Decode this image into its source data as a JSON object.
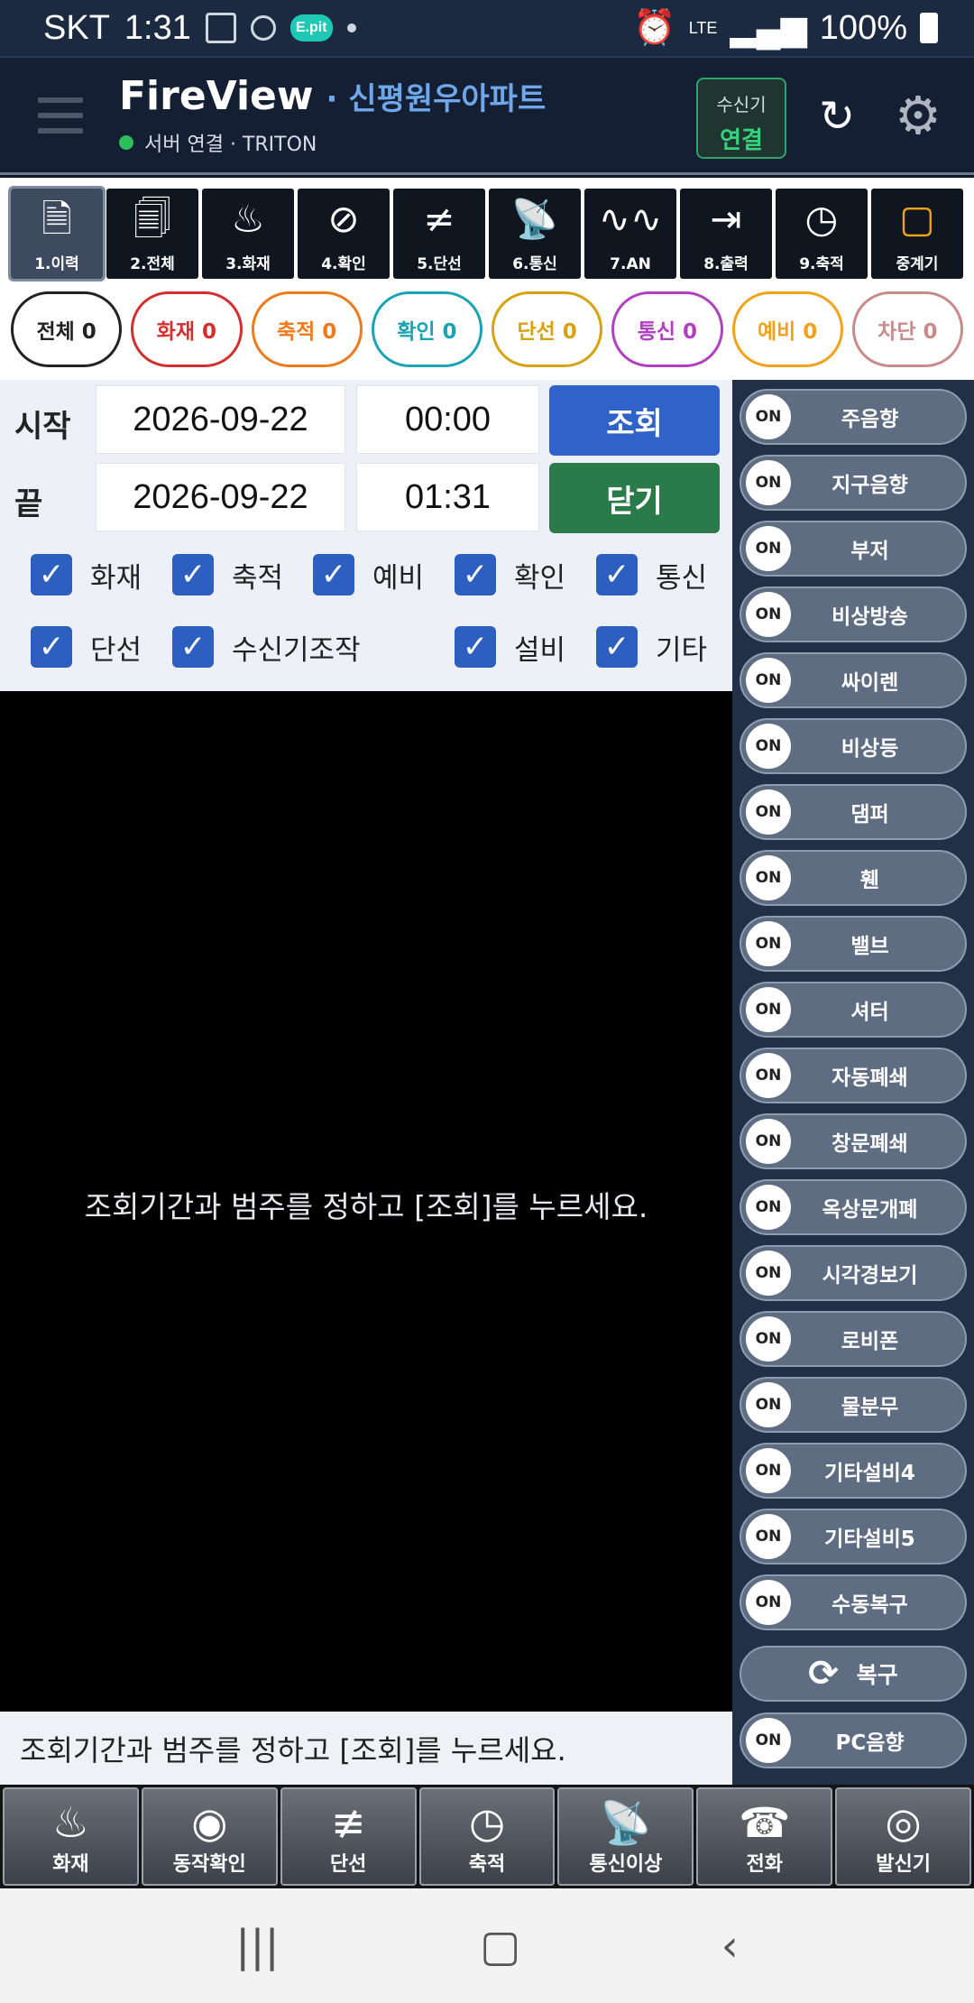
{
  "statusbar": {
    "carrier": "SKT",
    "time": "1:31",
    "notif_badge": "E.pit",
    "network": "LTE",
    "battery": "100%"
  },
  "header": {
    "app_title": "FireView",
    "site_name": "· 신평원우아파트",
    "server_status": "서버 연결 · TRITON",
    "receiver_label": "수신기",
    "receiver_status": "연결"
  },
  "toolbar": [
    {
      "label": "1.이력",
      "icon": "document-icon"
    },
    {
      "label": "2.전체",
      "icon": "documents-icon"
    },
    {
      "label": "3.화재",
      "icon": "fire-icon"
    },
    {
      "label": "4.확인",
      "icon": "magnifier-check-icon"
    },
    {
      "label": "5.단선",
      "icon": "broken-line-icon"
    },
    {
      "label": "6.통신",
      "icon": "satellite-dish-icon"
    },
    {
      "label": "7.AN",
      "icon": "wave-icon"
    },
    {
      "label": "8.출력",
      "icon": "exit-icon"
    },
    {
      "label": "9.축적",
      "icon": "clock-icon"
    },
    {
      "label": "중계기",
      "icon": "relay-icon"
    }
  ],
  "chips": [
    {
      "label": "전체 0",
      "color": "#222222"
    },
    {
      "label": "화재 0",
      "color": "#d32f2f"
    },
    {
      "label": "축적 0",
      "color": "#ef7a1c"
    },
    {
      "label": "확인 0",
      "color": "#1aa3b5"
    },
    {
      "label": "단선 0",
      "color": "#d6a210"
    },
    {
      "label": "통신 0",
      "color": "#b040c0"
    },
    {
      "label": "예비 0",
      "color": "#f1a21a"
    },
    {
      "label": "차단 0",
      "color": "#c98a8a"
    }
  ],
  "query": {
    "start_label": "시작",
    "end_label": "끝",
    "start_date": "2026-09-22",
    "start_time": "00:00",
    "end_date": "2026-09-22",
    "end_time": "01:31",
    "query_button": "조회",
    "close_button": "닫기",
    "checkboxes": [
      "화재",
      "축적",
      "예비",
      "확인",
      "통신",
      "단선",
      "수신기조작",
      "설비",
      "기타"
    ]
  },
  "messages": {
    "center": "조회기간과 범주를 정하고 [조회]를 누르세요.",
    "status": "조회기간과 범주를 정하고 [조회]를 누르세요."
  },
  "devices": {
    "on_label": "ON",
    "items": [
      "주음향",
      "지구음향",
      "부저",
      "비상방송",
      "싸이렌",
      "비상등",
      "댐퍼",
      "휀",
      "밸브",
      "셔터",
      "자동폐쇄",
      "창문폐쇄",
      "옥상문개폐",
      "시각경보기",
      "로비폰",
      "물분무",
      "기타설비4",
      "기타설비5",
      "수동복구"
    ],
    "restore_label": "복구",
    "pc_sound": "PC음향"
  },
  "actions": [
    {
      "label": "화재",
      "icon": "fire-icon"
    },
    {
      "label": "동작확인",
      "icon": "eye-icon"
    },
    {
      "label": "단선",
      "icon": "broken-line-icon"
    },
    {
      "label": "축적",
      "icon": "clock-icon"
    },
    {
      "label": "통신이상",
      "icon": "satellite-dish-icon"
    },
    {
      "label": "전화",
      "icon": "telephone-icon"
    },
    {
      "label": "발신기",
      "icon": "bell-icon"
    }
  ]
}
